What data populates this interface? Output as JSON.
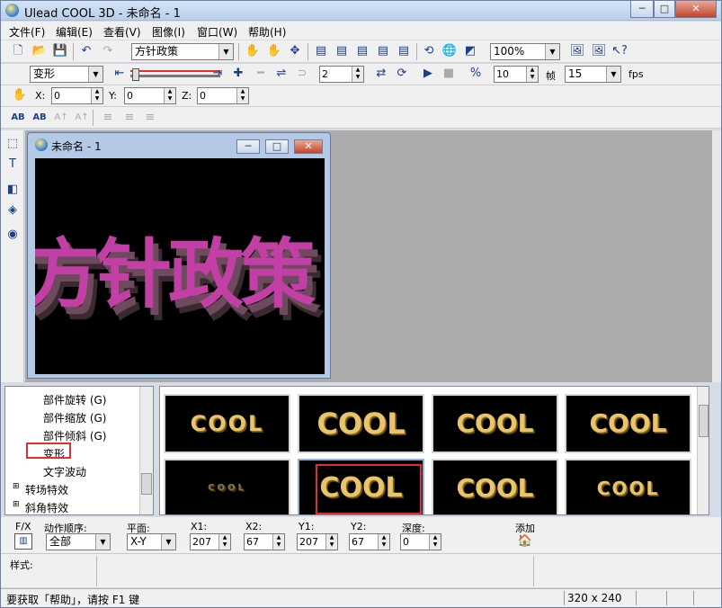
{
  "window": {
    "title": "Ulead COOL 3D - 未命名 - 1",
    "min": "─",
    "max": "□",
    "close": "✕"
  },
  "menu": [
    "文件(F)",
    "编辑(E)",
    "查看(V)",
    "图像(I)",
    "窗口(W)",
    "帮助(H)"
  ],
  "toolbar1": {
    "text_combo": "方针政策",
    "zoom_combo": "100%"
  },
  "toolbar2": {
    "effect_combo": "变形",
    "frame_value": "2",
    "frames": "10",
    "frame_label": "帧",
    "fps_value": "15",
    "fps_label": "fps"
  },
  "toolbar3": {
    "x_label": "X:",
    "x_value": "0",
    "y_label": "Y:",
    "y_value": "0",
    "z_label": "Z:",
    "z_value": "0"
  },
  "toolbar4": {
    "font_icons": [
      "AB",
      "AB",
      "A↑",
      "A↑"
    ]
  },
  "child": {
    "title": "未命名 - 1",
    "canvas_text": "方针政策"
  },
  "tree": {
    "items": [
      "部件旋转 (G)",
      "部件缩放 (G)",
      "部件倾斜 (G)",
      "变形",
      "文字波动",
      "转场特效",
      "斜角特效"
    ]
  },
  "thumbs": [
    "COOL",
    "COOL",
    "COOL",
    "COOL",
    "COOL",
    "COOL",
    "COOL",
    "COOL"
  ],
  "props": {
    "fx_label": "F/X",
    "order_label": "动作顺序:",
    "order_value": "全部",
    "plane_label": "平面:",
    "plane_value": "X-Y",
    "x1_label": "X1:",
    "x1_value": "207",
    "x2_label": "X2:",
    "x2_value": "67",
    "y1_label": "Y1:",
    "y1_value": "207",
    "y2_label": "Y2:",
    "y2_value": "67",
    "depth_label": "深度:",
    "depth_value": "0",
    "add_label": "添加"
  },
  "style_label": "样式:",
  "status": {
    "help": "要获取「帮助」，请按 F1 键",
    "size": "320 x 240"
  }
}
